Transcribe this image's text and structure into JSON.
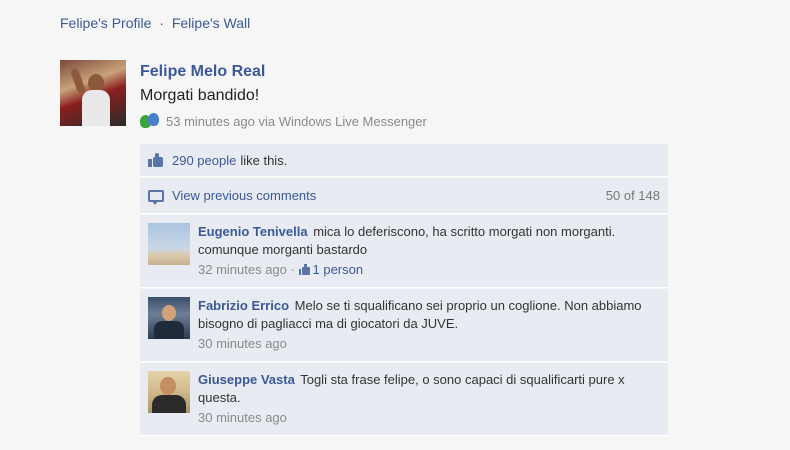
{
  "breadcrumb": {
    "profile": "Felipe's Profile",
    "separator": "·",
    "wall": "Felipe's Wall"
  },
  "post": {
    "author": "Felipe Melo Real",
    "message": "Morgati bandido!",
    "meta": "53 minutes ago via Windows Live Messenger"
  },
  "likes": {
    "count": "290 people",
    "suffix": "like this."
  },
  "previous_comments": {
    "label": "View previous comments",
    "count": "50 of 148"
  },
  "comments": [
    {
      "name": "Eugenio Tenivella",
      "text": "mica lo deferiscono, ha scritto morgati non morganti. comunque morganti bastardo",
      "time": "32 minutes ago",
      "separator": "·",
      "likes": "1 person"
    },
    {
      "name": "Fabrizio Errico",
      "text": "Melo se ti squalificano sei proprio un coglione. Non abbiamo bisogno di pagliacci ma di giocatori da JUVE.",
      "time": "30 minutes ago"
    },
    {
      "name": "Giuseppe Vasta",
      "text": "Togli sta frase felipe, o sono capaci di squalificarti pure x questa.",
      "time": "30 minutes ago"
    }
  ],
  "colors": {
    "link": "#3b5998",
    "ufi_background": "#e8ebf2",
    "meta_text": "#8a8a8a"
  },
  "icons": [
    "messenger-icon",
    "thumbs-up-icon",
    "comment-icon"
  ]
}
